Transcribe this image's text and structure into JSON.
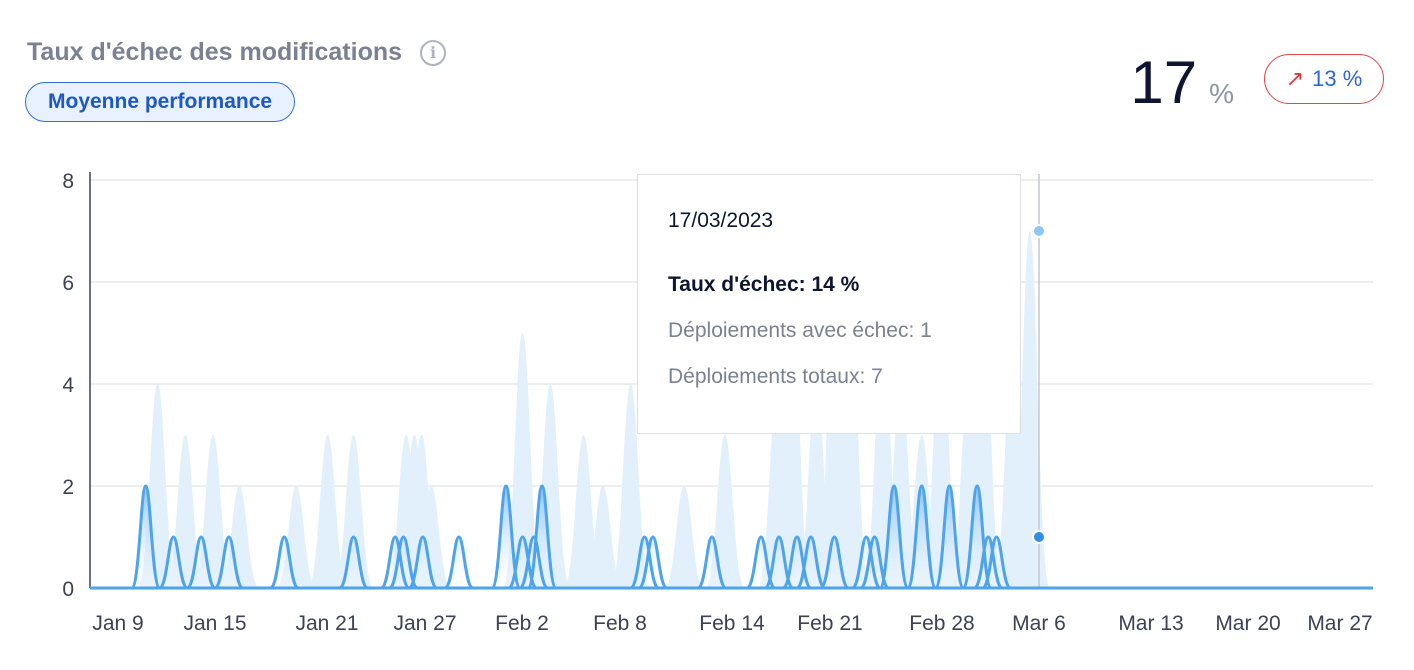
{
  "header": {
    "title": "Taux d'échec des modifications",
    "info_icon": "info-icon",
    "badge": "Moyenne performance",
    "kpi_value": "17",
    "kpi_unit": "%",
    "delta_value": "13 %",
    "delta_icon": "arrow-up-right-icon"
  },
  "tooltip": {
    "date": "17/03/2023",
    "rate": "Taux d'échec: 14 %",
    "failed": "Déploiements avec échec: 1",
    "total": "Déploiements totaux: 7"
  },
  "colors": {
    "line": "#4da3ec",
    "area_total": "#e2f0fc",
    "badge_border": "#2f6fd8",
    "delta_border": "#e0484a"
  },
  "chart_data": {
    "type": "area",
    "ylim": [
      0,
      8
    ],
    "y_ticks": [
      0,
      2,
      4,
      6,
      8
    ],
    "x_ticks": [
      "Jan 9",
      "Jan 15",
      "Jan 21",
      "Jan 27",
      "Feb 2",
      "Feb 8",
      "Feb 14",
      "Feb 21",
      "Feb 28",
      "Mar 6",
      "Mar 13",
      "Mar 20",
      "Mar 27"
    ],
    "series": [
      {
        "role": "total",
        "peaks": [
          [
            1.43,
            4
          ],
          [
            2.43,
            3
          ],
          [
            3.43,
            3
          ],
          [
            4.38,
            2
          ],
          [
            6.43,
            2
          ],
          [
            7.57,
            3
          ],
          [
            8.5,
            3
          ],
          [
            10.4,
            3
          ],
          [
            10.7,
            3
          ],
          [
            10.95,
            3
          ],
          [
            11.3,
            2
          ],
          [
            14.6,
            5
          ],
          [
            15.6,
            4
          ],
          [
            16.8,
            3
          ],
          [
            17.5,
            2
          ],
          [
            18.5,
            4
          ],
          [
            20.43,
            2
          ],
          [
            21.9,
            3
          ],
          [
            23.8,
            4
          ],
          [
            24.3,
            6
          ],
          [
            25.2,
            4
          ],
          [
            25.9,
            7
          ],
          [
            26.4,
            6
          ],
          [
            27.6,
            5
          ],
          [
            28.25,
            4
          ],
          [
            29.0,
            3
          ],
          [
            29.7,
            5
          ],
          [
            30.7,
            4
          ],
          [
            31.2,
            6
          ],
          [
            32.3,
            5
          ],
          [
            32.9,
            7
          ]
        ]
      },
      {
        "role": "failed",
        "peaks": [
          [
            1.0,
            2
          ],
          [
            2.0,
            1
          ],
          [
            3.0,
            1
          ],
          [
            4.0,
            1
          ],
          [
            6.0,
            1
          ],
          [
            8.5,
            1
          ],
          [
            10.0,
            1
          ],
          [
            10.3,
            1
          ],
          [
            11.0,
            1
          ],
          [
            12.3,
            1
          ],
          [
            14.0,
            2
          ],
          [
            14.6,
            1
          ],
          [
            15.0,
            1
          ],
          [
            15.3,
            2
          ],
          [
            19.0,
            1
          ],
          [
            19.3,
            1
          ],
          [
            21.43,
            1
          ],
          [
            23.2,
            1
          ],
          [
            23.85,
            1
          ],
          [
            24.5,
            1
          ],
          [
            25.0,
            1
          ],
          [
            25.85,
            1
          ],
          [
            27.0,
            1
          ],
          [
            27.3,
            1
          ],
          [
            28.0,
            2
          ],
          [
            29.0,
            2
          ],
          [
            30.0,
            2
          ],
          [
            31.0,
            2
          ],
          [
            31.4,
            1
          ],
          [
            31.7,
            1
          ]
        ]
      }
    ],
    "highlight": {
      "x": "Mar 17",
      "total": 7,
      "failed": 1
    }
  }
}
